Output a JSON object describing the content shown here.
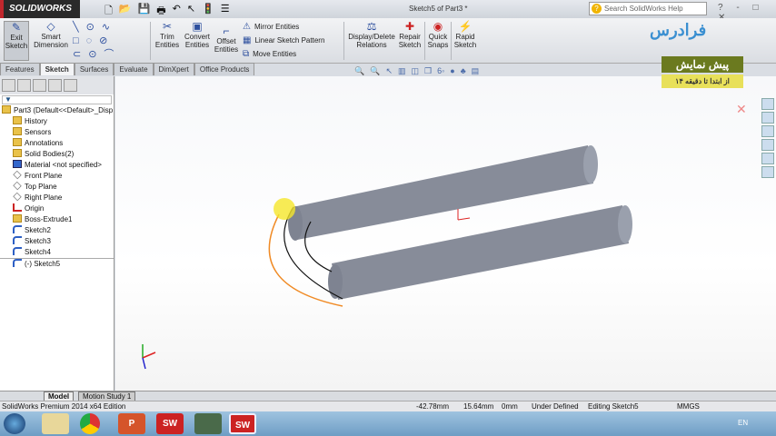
{
  "app": {
    "logo": "SOLIDWORKS",
    "title": "Sketch5 of Part3 *",
    "search_placeholder": "Search SolidWorks Help",
    "window_controls": "? - □ ✕"
  },
  "qat_icons": [
    "new-icon",
    "open-icon",
    "save-icon",
    "print-icon",
    "undo-icon",
    "select-icon",
    "rebuild-icon",
    "options-icon"
  ],
  "ribbon": {
    "exit_sketch": "Exit Sketch",
    "smart_dimension": "Smart Dimension",
    "trim": "Trim Entities",
    "convert": "Convert Entities",
    "offset": "Offset Entities",
    "mirror": "Mirror Entities",
    "linear_pattern": "Linear Sketch Pattern",
    "move": "Move Entities",
    "display_delete": "Display/Delete Relations",
    "repair": "Repair Sketch",
    "quick_snaps": "Quick Snaps",
    "rapid_sketch": "Rapid Sketch"
  },
  "tabs": [
    {
      "label": "Features"
    },
    {
      "label": "Sketch",
      "active": true
    },
    {
      "label": "Surfaces"
    },
    {
      "label": "Evaluate"
    },
    {
      "label": "DimXpert"
    },
    {
      "label": "Office Products"
    }
  ],
  "tree": {
    "root": "Part3  (Default<<Default>_Disp",
    "items": [
      "History",
      "Sensors",
      "Annotations",
      "Solid Bodies(2)",
      "Material <not specified>",
      "Front Plane",
      "Top Plane",
      "Right Plane",
      "Origin",
      "Boss-Extrude1",
      "Sketch2",
      "Sketch3",
      "Sketch4",
      "(-) Sketch5"
    ]
  },
  "overlay": {
    "brand": "فرادرس",
    "promo_title": "پیش نمایش",
    "promo_sub": "از ابتدا تا دقیقه ۱۴"
  },
  "bottom_tabs": [
    "Model",
    "Motion Study 1"
  ],
  "status": {
    "edition": "SolidWorks Premium 2014 x64 Edition",
    "x": "-42.78mm",
    "y": "15.64mm",
    "z": "0mm",
    "state": "Under Defined",
    "editing": "Editing Sketch5",
    "units": "MMGS"
  },
  "taskbar": {
    "lang": "EN",
    "apps": [
      "start",
      "explorer",
      "chrome",
      "powerpoint",
      "solidworks",
      "app",
      "solidworks-active"
    ]
  },
  "colors": {
    "accent": "#2d4f9e",
    "cylinder": "#858a98",
    "sketch_arc": "#f08a24",
    "promo": "#6b7a1f"
  }
}
